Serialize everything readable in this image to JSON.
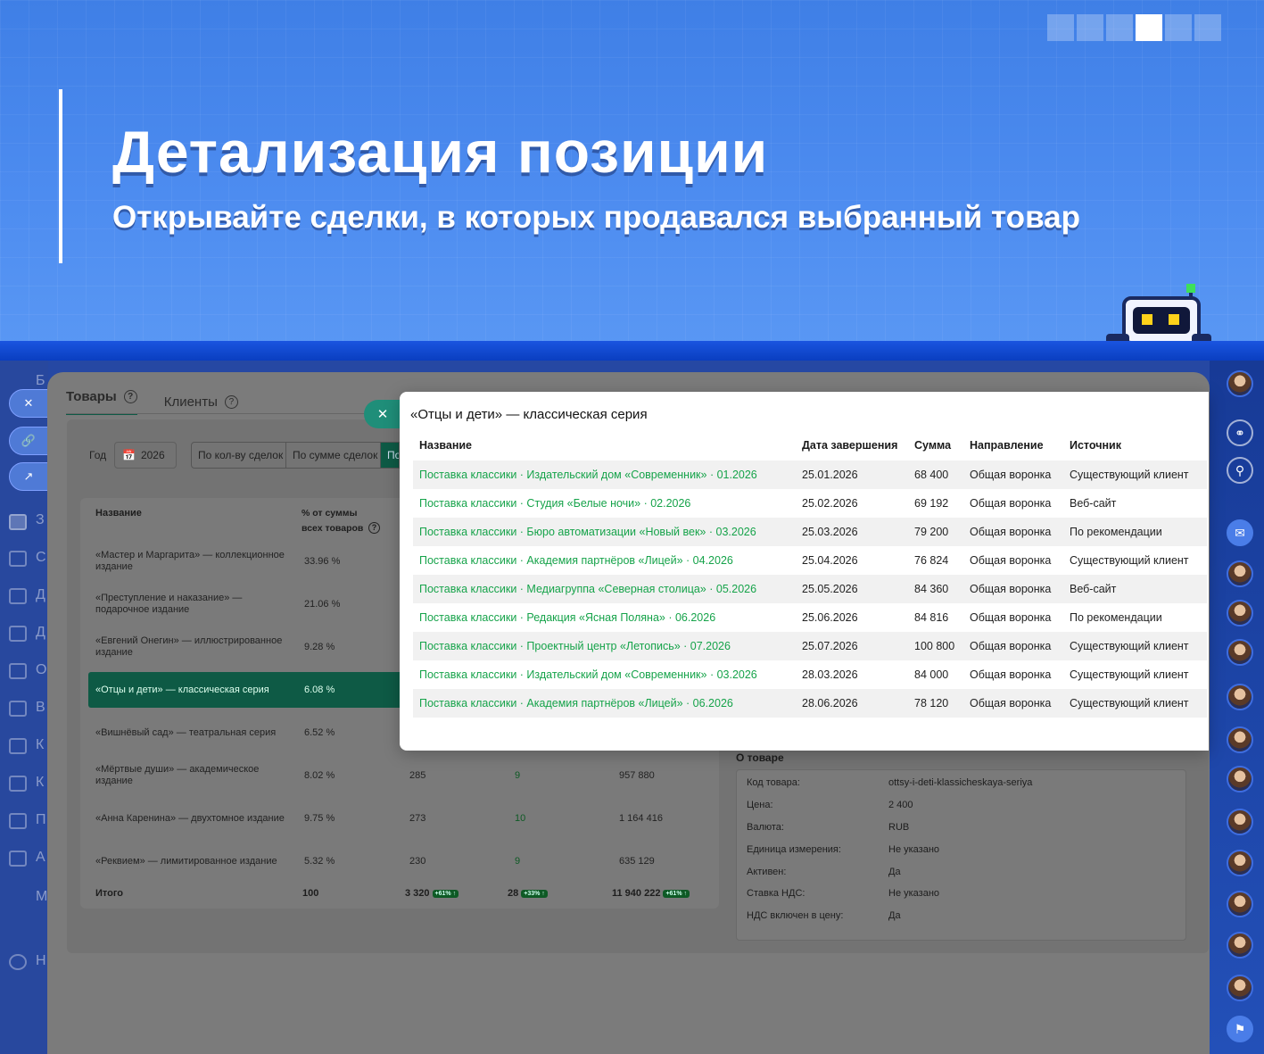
{
  "banner": {
    "title": "Детализация позиции",
    "subtitle": "Открывайте сделки, в которых продавался выбранный товар"
  },
  "tabs": [
    {
      "label": "Товары",
      "active": true
    },
    {
      "label": "Клиенты",
      "active": false
    }
  ],
  "filters": {
    "year_label": "Год",
    "year_value": "2026",
    "segments": [
      "По кол-ву сделок",
      "По сумме сделок",
      "По"
    ]
  },
  "products_table": {
    "headers": {
      "name": "Название",
      "percent_line1": "% от суммы",
      "percent_line2": "всех товаров"
    },
    "rows": [
      {
        "name": "«Мастер и Маргарита» — коллекционное издание",
        "percent": "33.96 %",
        "col3": "",
        "col4": "",
        "col5": ""
      },
      {
        "name": "«Преступление и наказание» — подарочное издание",
        "percent": "21.06 %",
        "col3": "",
        "col4": "",
        "col5": ""
      },
      {
        "name": "«Евгений Онегин» — иллюстрированное издание",
        "percent": "9.28 %",
        "col3": "",
        "col4": "",
        "col5": ""
      },
      {
        "name": "«Отцы и дети» — классическая серия",
        "percent": "6.08 %",
        "col3": "",
        "col4": "",
        "col5": "",
        "selected": true
      },
      {
        "name": "«Вишнёвый сад» — театральная серия",
        "percent": "6.52 %",
        "col3": "",
        "col4": "",
        "col5": ""
      },
      {
        "name": "«Мёртвые души» — академическое издание",
        "percent": "8.02 %",
        "col3": "285",
        "col4": "9",
        "col5": "957 880"
      },
      {
        "name": "«Анна Каренина» — двухтомное издание",
        "percent": "9.75 %",
        "col3": "273",
        "col4": "10",
        "col5": "1 164 416"
      },
      {
        "name": "«Реквием» — лимитированное издание",
        "percent": "5.32 %",
        "col3": "230",
        "col4": "9",
        "col5": "635 129"
      }
    ],
    "total": {
      "label": "Итого",
      "percent": "100",
      "col3": "3 320",
      "col3_badge": "+61% ↑",
      "col4": "28",
      "col4_badge": "+33% ↑",
      "col5": "11 940 222",
      "col5_badge": "+61% ↑"
    }
  },
  "about": {
    "title": "О товаре",
    "rows": [
      {
        "label": "Код товара:",
        "value": "ottsy-i-deti-klassicheskaya-seriya"
      },
      {
        "label": "Цена:",
        "value": "2 400"
      },
      {
        "label": "Валюта:",
        "value": "RUB"
      },
      {
        "label": "Единица измерения:",
        "value": "Не указано"
      },
      {
        "label": "Активен:",
        "value": "Да"
      },
      {
        "label": "Ставка НДС:",
        "value": "Не указано"
      },
      {
        "label": "НДС включен в цену:",
        "value": "Да"
      }
    ]
  },
  "modal": {
    "title": "«Отцы и дети» — классическая серия",
    "headers": {
      "name": "Название",
      "date": "Дата завершения",
      "sum": "Сумма",
      "funnel": "Направление",
      "source": "Источник"
    },
    "rows": [
      {
        "name": "Поставка классики · Издательский дом «Современник» · 01.2026",
        "date": "25.01.2026",
        "sum": "68 400",
        "funnel": "Общая воронка",
        "source": "Существующий клиент"
      },
      {
        "name": "Поставка классики · Студия «Белые ночи» · 02.2026",
        "date": "25.02.2026",
        "sum": "69 192",
        "funnel": "Общая воронка",
        "source": "Веб-сайт"
      },
      {
        "name": "Поставка классики · Бюро автоматизации «Новый век» · 03.2026",
        "date": "25.03.2026",
        "sum": "79 200",
        "funnel": "Общая воронка",
        "source": "По рекомендации"
      },
      {
        "name": "Поставка классики · Академия партнёров «Лицей» · 04.2026",
        "date": "25.04.2026",
        "sum": "76 824",
        "funnel": "Общая воронка",
        "source": "Существующий клиент"
      },
      {
        "name": "Поставка классики · Медиагруппа «Северная столица» · 05.2026",
        "date": "25.05.2026",
        "sum": "84 360",
        "funnel": "Общая воронка",
        "source": "Веб-сайт"
      },
      {
        "name": "Поставка классики · Редакция «Ясная Поляна» · 06.2026",
        "date": "25.06.2026",
        "sum": "84 816",
        "funnel": "Общая воронка",
        "source": "По рекомендации"
      },
      {
        "name": "Поставка классики · Проектный центр «Летопись» · 07.2026",
        "date": "25.07.2026",
        "sum": "100 800",
        "funnel": "Общая воронка",
        "source": "Существующий клиент"
      },
      {
        "name": "Поставка классики · Издательский дом «Современник» · 03.2026",
        "date": "28.03.2026",
        "sum": "84 000",
        "funnel": "Общая воронка",
        "source": "Существующий клиент"
      },
      {
        "name": "Поставка классики · Академия партнёров «Лицей» · 06.2026",
        "date": "28.06.2026",
        "sum": "78 120",
        "funnel": "Общая воронка",
        "source": "Существующий клиент"
      }
    ]
  },
  "sidebar_letters": [
    "Б",
    "З",
    "С",
    "Д",
    "Д",
    "О",
    "В",
    "К",
    "К",
    "П",
    "А",
    "M",
    "Н"
  ],
  "colors": {
    "accent": "#0e5a45",
    "link": "#16a34a",
    "banner": "#4d8cf0"
  }
}
